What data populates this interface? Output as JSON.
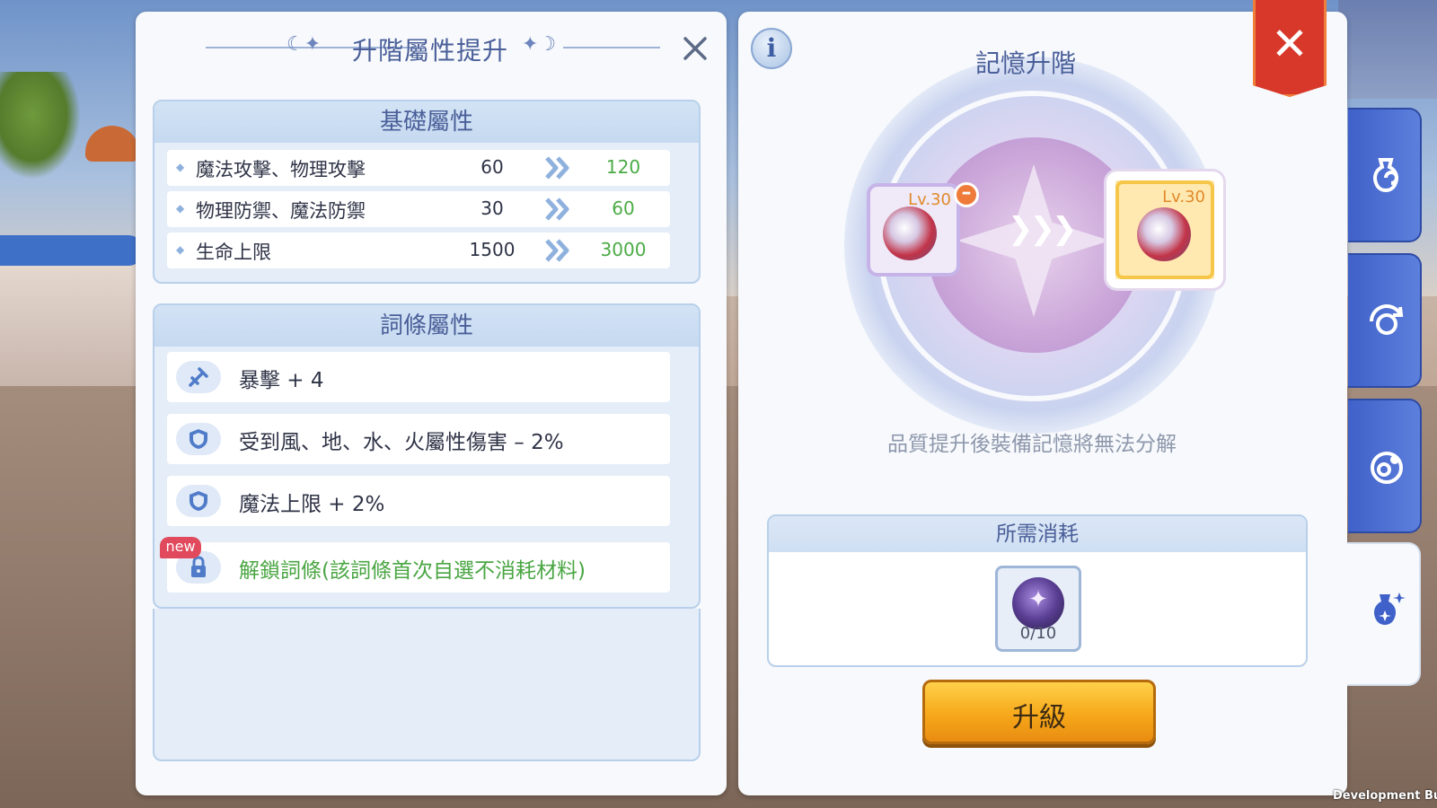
{
  "left_panel": {
    "title": "升階屬性提升",
    "base_section": {
      "title": "基礎屬性",
      "rows": [
        {
          "name": "魔法攻擊、物理攻擊",
          "old": "60",
          "new": "120"
        },
        {
          "name": "物理防禦、魔法防禦",
          "old": "30",
          "new": "60"
        },
        {
          "name": "生命上限",
          "old": "1500",
          "new": "3000"
        }
      ]
    },
    "affix_section": {
      "title": "詞條屬性",
      "rows": [
        {
          "text": "暴擊 + 4",
          "icon": "crit-sword-icon"
        },
        {
          "text": "受到風、地、水、火屬性傷害 – 2%",
          "icon": "shield-icon"
        },
        {
          "text": "魔法上限 + 2%",
          "icon": "shield-icon"
        }
      ],
      "locked_row": {
        "badge": "new",
        "text": "解鎖詞條(該詞條首次自選不消耗材料)",
        "icon": "lock-icon"
      }
    }
  },
  "right_panel": {
    "title": "記憶升階",
    "from_level": "Lv.30",
    "to_level": "Lv.30",
    "warning": "品質提升後裝備記憶將無法分解",
    "cost": {
      "title": "所需消耗",
      "count": "0/10"
    },
    "upgrade_label": "升級"
  },
  "colors": {
    "accent_blue": "#4a5f99",
    "increase_green": "#4bab45",
    "close_red": "#d8382a",
    "button_orange": "#f6a81a",
    "tab_blue": "#3f61c9"
  },
  "side_tabs": [
    {
      "icon": "potion-refresh-icon"
    },
    {
      "icon": "cycle-icon"
    },
    {
      "icon": "orbit-icon"
    },
    {
      "icon": "sparkle-potion-icon",
      "active": true
    }
  ],
  "footer": {
    "build_label": "Development Build"
  }
}
